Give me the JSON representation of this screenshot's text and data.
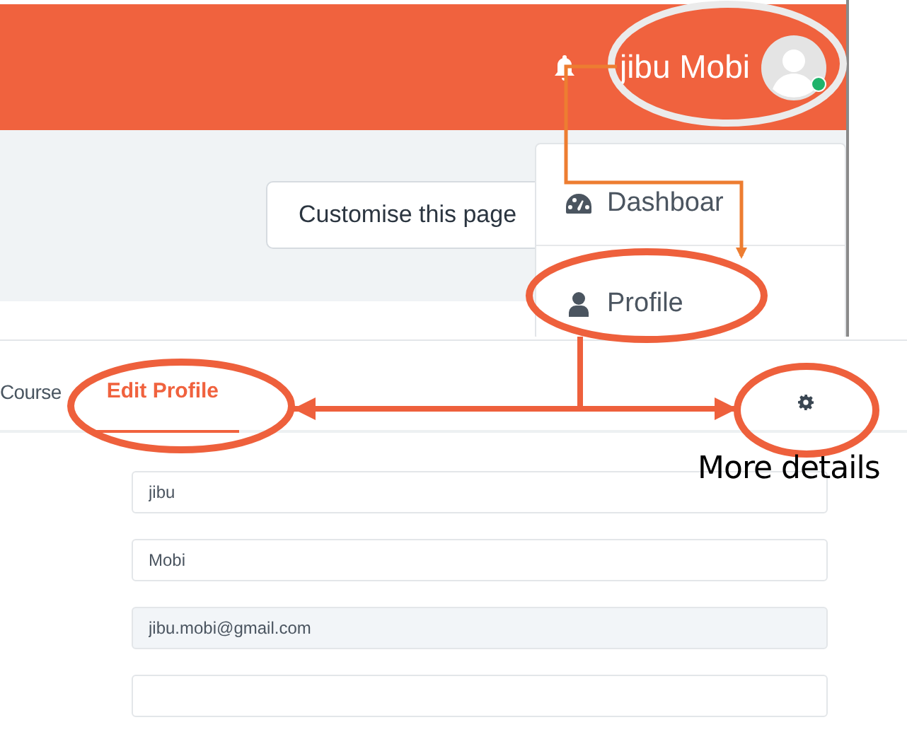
{
  "header": {
    "user_name": "jibu Mobi",
    "online": true
  },
  "customise_button": "Customise this page",
  "user_menu": {
    "items": [
      {
        "kind": "dashboard",
        "label": "Dashboar",
        "selected": false
      },
      {
        "kind": "profile",
        "label": "Profile",
        "selected": false
      }
    ]
  },
  "tabs": [
    {
      "label": "Course",
      "selected": false
    },
    {
      "label": "Edit Profile",
      "selected": true
    }
  ],
  "fields": [
    {
      "value": "jibu",
      "disabled": false
    },
    {
      "value": "Mobi",
      "disabled": false
    },
    {
      "value": "jibu.mobi@gmail.com",
      "disabled": true
    },
    {
      "disabled": false
    }
  ],
  "annotation": {
    "caption": "More details"
  }
}
